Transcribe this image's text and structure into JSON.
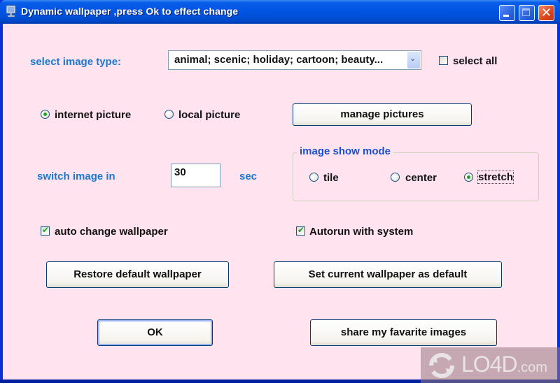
{
  "window": {
    "title": "Dynamic wallpaper ,press Ok to effect change",
    "app_icon": "monitor-icon",
    "controls": {
      "minimize": "minimize-icon",
      "maximize": "maximize-icon",
      "close": "close-icon",
      "close_glyph": "✕"
    },
    "colors": {
      "client_background": "#ffe3ee",
      "titlebar": "#0054e3",
      "label_blue": "#1a78d0",
      "group_title_blue": "#1a4fd0",
      "check_green": "#21a121"
    }
  },
  "image_type": {
    "label": "select image type:",
    "selected_value": "animal; scenic; holiday; cartoon; beauty...",
    "dropdown_arrow": "⌄",
    "select_all_label": "select all",
    "select_all_checked": false
  },
  "source": {
    "options": [
      {
        "label": "internet picture",
        "selected": true
      },
      {
        "label": "local picture",
        "selected": false
      }
    ],
    "manage_button": "manage pictures"
  },
  "switch": {
    "label": "switch image in",
    "value": "30",
    "unit": "sec"
  },
  "show_mode": {
    "title": "image show mode",
    "options": [
      {
        "label": "tile",
        "selected": false
      },
      {
        "label": "center",
        "selected": false
      },
      {
        "label": "stretch",
        "selected": true
      }
    ]
  },
  "options": {
    "auto_change": {
      "label": "auto change wallpaper",
      "checked": true
    },
    "autorun": {
      "label": "Autorun with system",
      "checked": true
    },
    "check_glyph": "✔"
  },
  "buttons": {
    "restore": "Restore default wallpaper",
    "set_default": "Set current wallpaper as default",
    "ok": "OK",
    "share": "share my favarite images"
  },
  "watermark": {
    "brand": "LO4D",
    "suffix": ".com"
  }
}
